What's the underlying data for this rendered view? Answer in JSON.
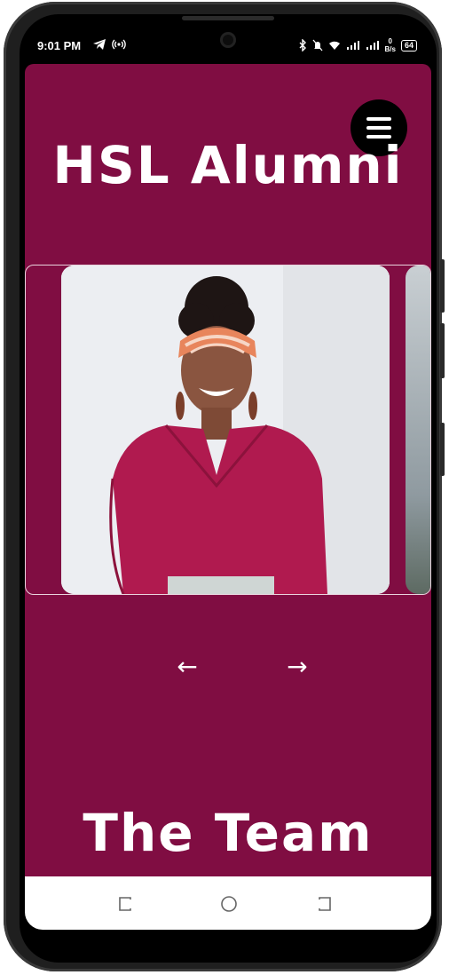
{
  "status_bar": {
    "time": "9:01 PM",
    "left_icons": [
      "telegram-icon",
      "hotspot-icon"
    ],
    "right_icons": [
      "bluetooth-icon",
      "mute-icon",
      "wifi-icon",
      "signal-icon",
      "signal-icon"
    ],
    "net_speed_value": "0",
    "net_speed_unit": "B/s",
    "battery": "64"
  },
  "app": {
    "background_color": "#800d42",
    "title": "HSL Alumni",
    "menu_icon": "hamburger-menu-icon",
    "carousel": {
      "prev_arrow": "←",
      "next_arrow": "→"
    },
    "section_heading": "The Team"
  },
  "nav_bar": {
    "buttons": [
      "recent-apps-icon",
      "home-icon",
      "back-icon"
    ]
  }
}
